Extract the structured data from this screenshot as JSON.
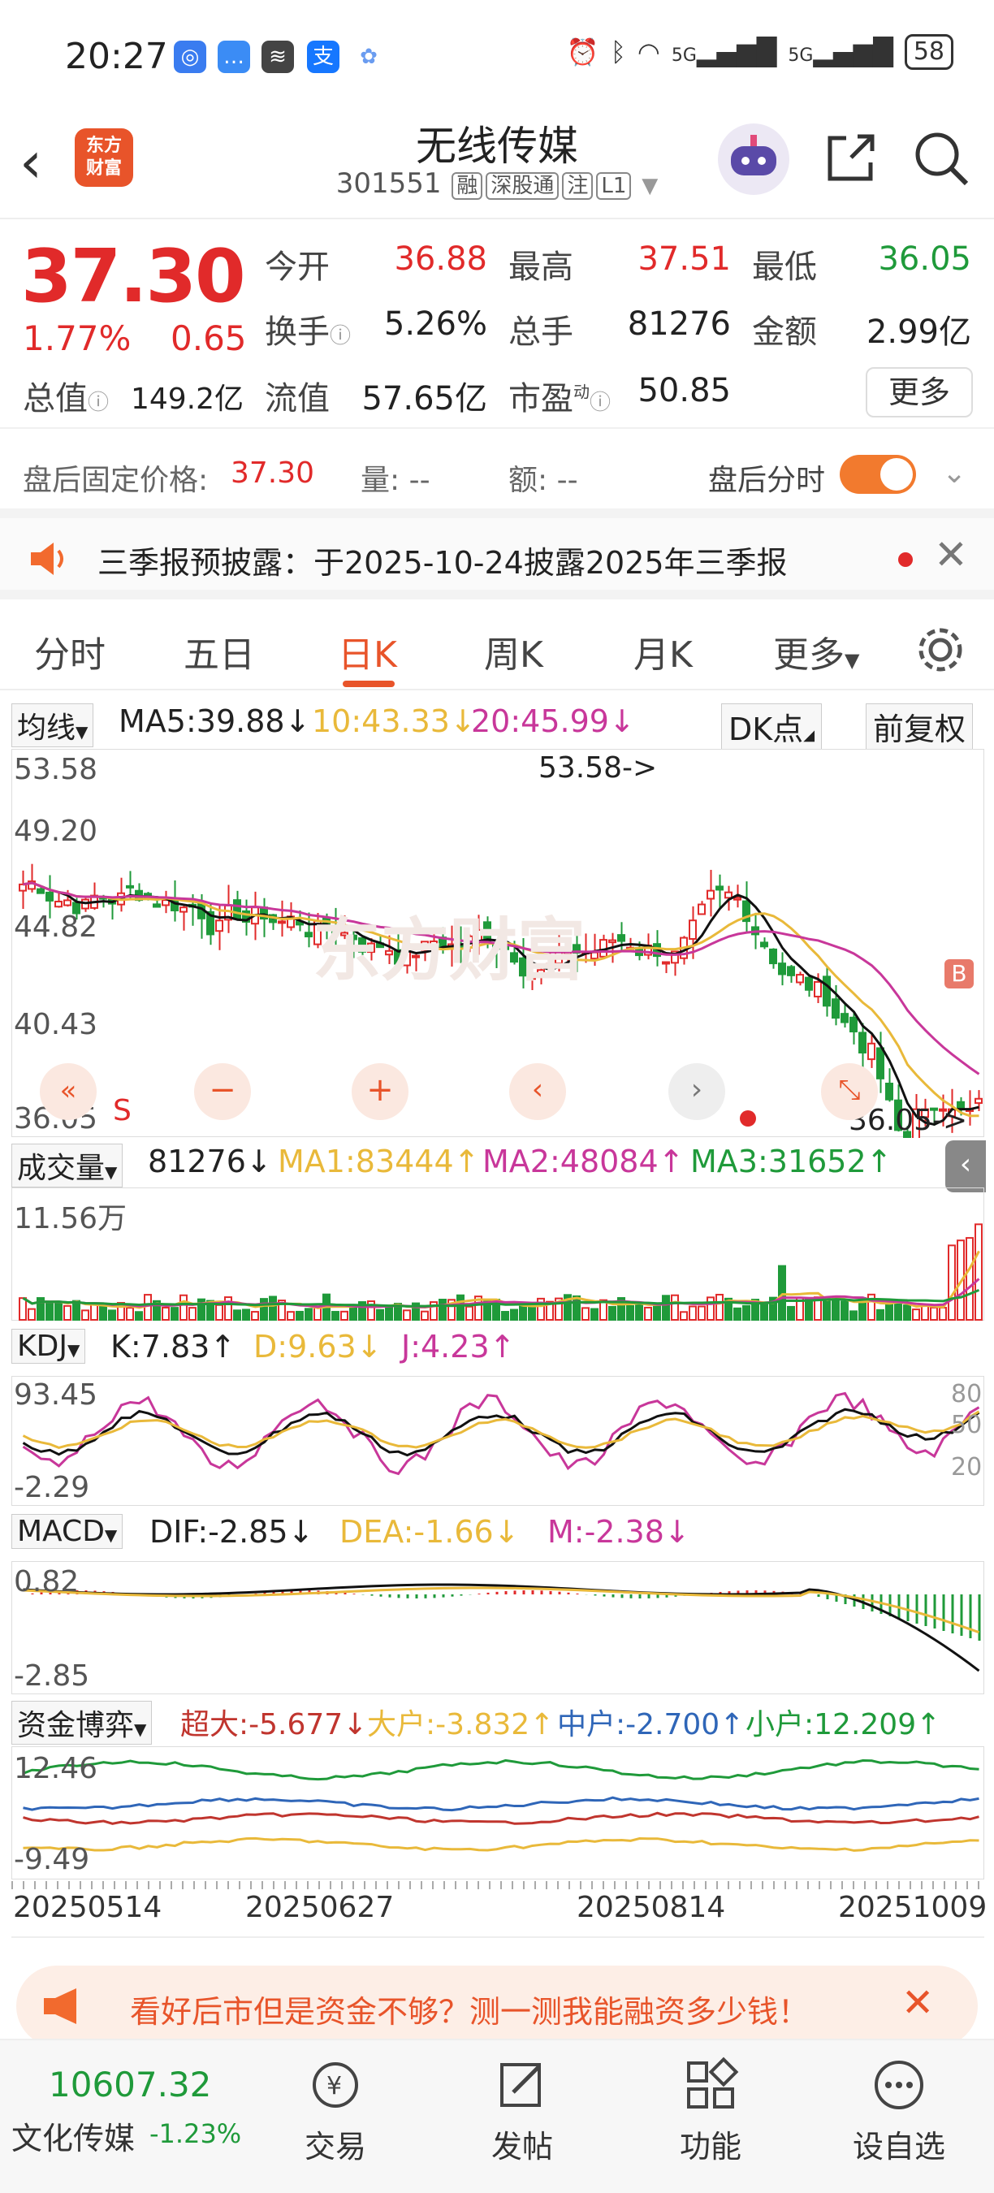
{
  "status_bar": {
    "time": "20:27",
    "network": "5G",
    "network2": "5G",
    "battery": "58"
  },
  "header": {
    "logo_line1": "东方",
    "logo_line2": "财富",
    "stock_name": "无线传媒",
    "stock_code": "301551",
    "tags": [
      "融",
      "深股通",
      "注",
      "L1"
    ]
  },
  "quote": {
    "price": "37.30",
    "change_pct": "1.77%",
    "change": "0.65",
    "open_label": "今开",
    "open": "36.88",
    "high_label": "最高",
    "high": "37.51",
    "low_label": "最低",
    "low": "36.05",
    "turnover_label": "换手",
    "turnover": "5.26%",
    "volume_label": "总手",
    "volume": "81276",
    "amount_label": "金额",
    "amount": "2.99亿",
    "mcap_label": "总值",
    "mcap": "149.2亿",
    "float_label": "流值",
    "float": "57.65亿",
    "pe_label": "市盈",
    "pe_sup": "动",
    "pe": "50.85",
    "more_label": "更多"
  },
  "after_hours": {
    "label": "盘后固定价格:",
    "price": "37.30",
    "vol_label": "量: --",
    "amt_label": "额: --",
    "timeshare_label": "盘后分时"
  },
  "notice": {
    "text": "三季报预披露：于2025-10-24披露2025年三季报"
  },
  "tabs": [
    "分时",
    "五日",
    "日K",
    "周K",
    "月K",
    "更多"
  ],
  "active_tab": "日K",
  "kline": {
    "dropdown": "均线",
    "ma5": "MA5:39.88",
    "ma10": "10:43.33",
    "ma20": "20:45.99",
    "dk_label": "DK点",
    "adjust_label": "前复权",
    "y_ticks": [
      "53.58",
      "49.20",
      "44.82",
      "40.43",
      "36.05"
    ],
    "max_annot": "53.58->",
    "min_annot": "36.05->",
    "buy_marker": "B",
    "s_marker": "S",
    "watermark": "东方财富"
  },
  "volume_panel": {
    "dropdown": "成交量",
    "value": "81276",
    "ma1": "MA1:83444",
    "ma2": "MA2:48084",
    "ma3": "MA3:31652",
    "y_top": "11.56万"
  },
  "kdj_panel": {
    "dropdown": "KDJ",
    "k": "K:7.83",
    "d": "D:9.63",
    "j": "J:4.23",
    "y_top": "93.45",
    "y_bot": "-2.29",
    "r80": "80",
    "r50": "50",
    "r20": "20"
  },
  "macd_panel": {
    "dropdown": "MACD",
    "dif": "DIF:-2.85",
    "dea": "DEA:-1.66",
    "m": "M:-2.38",
    "y_top": "0.82",
    "y_bot": "-2.85"
  },
  "fund_panel": {
    "dropdown": "资金博弈",
    "super": "超大:-5.677",
    "large": "大户:-3.832",
    "mid": "中户:-2.700",
    "small": "小户:12.209",
    "y_top": "12.46",
    "y_bot": "-9.49"
  },
  "x_dates": [
    "20250514",
    "20250627",
    "20250814",
    "20251009"
  ],
  "ad": {
    "text": "看好后市但是资金不够？测一测我能融资多少钱！"
  },
  "bottom_bar": {
    "index_value": "10607.32",
    "index_name": "文化传媒",
    "index_change": "-1.23%",
    "items": [
      "交易",
      "发帖",
      "功能",
      "设自选"
    ]
  },
  "colors": {
    "up": "#e12a2a",
    "down": "#1f9a3a",
    "accent": "#e8542a",
    "ma5": "#111111",
    "ma10": "#e9b93a",
    "ma20": "#c8379a"
  }
}
